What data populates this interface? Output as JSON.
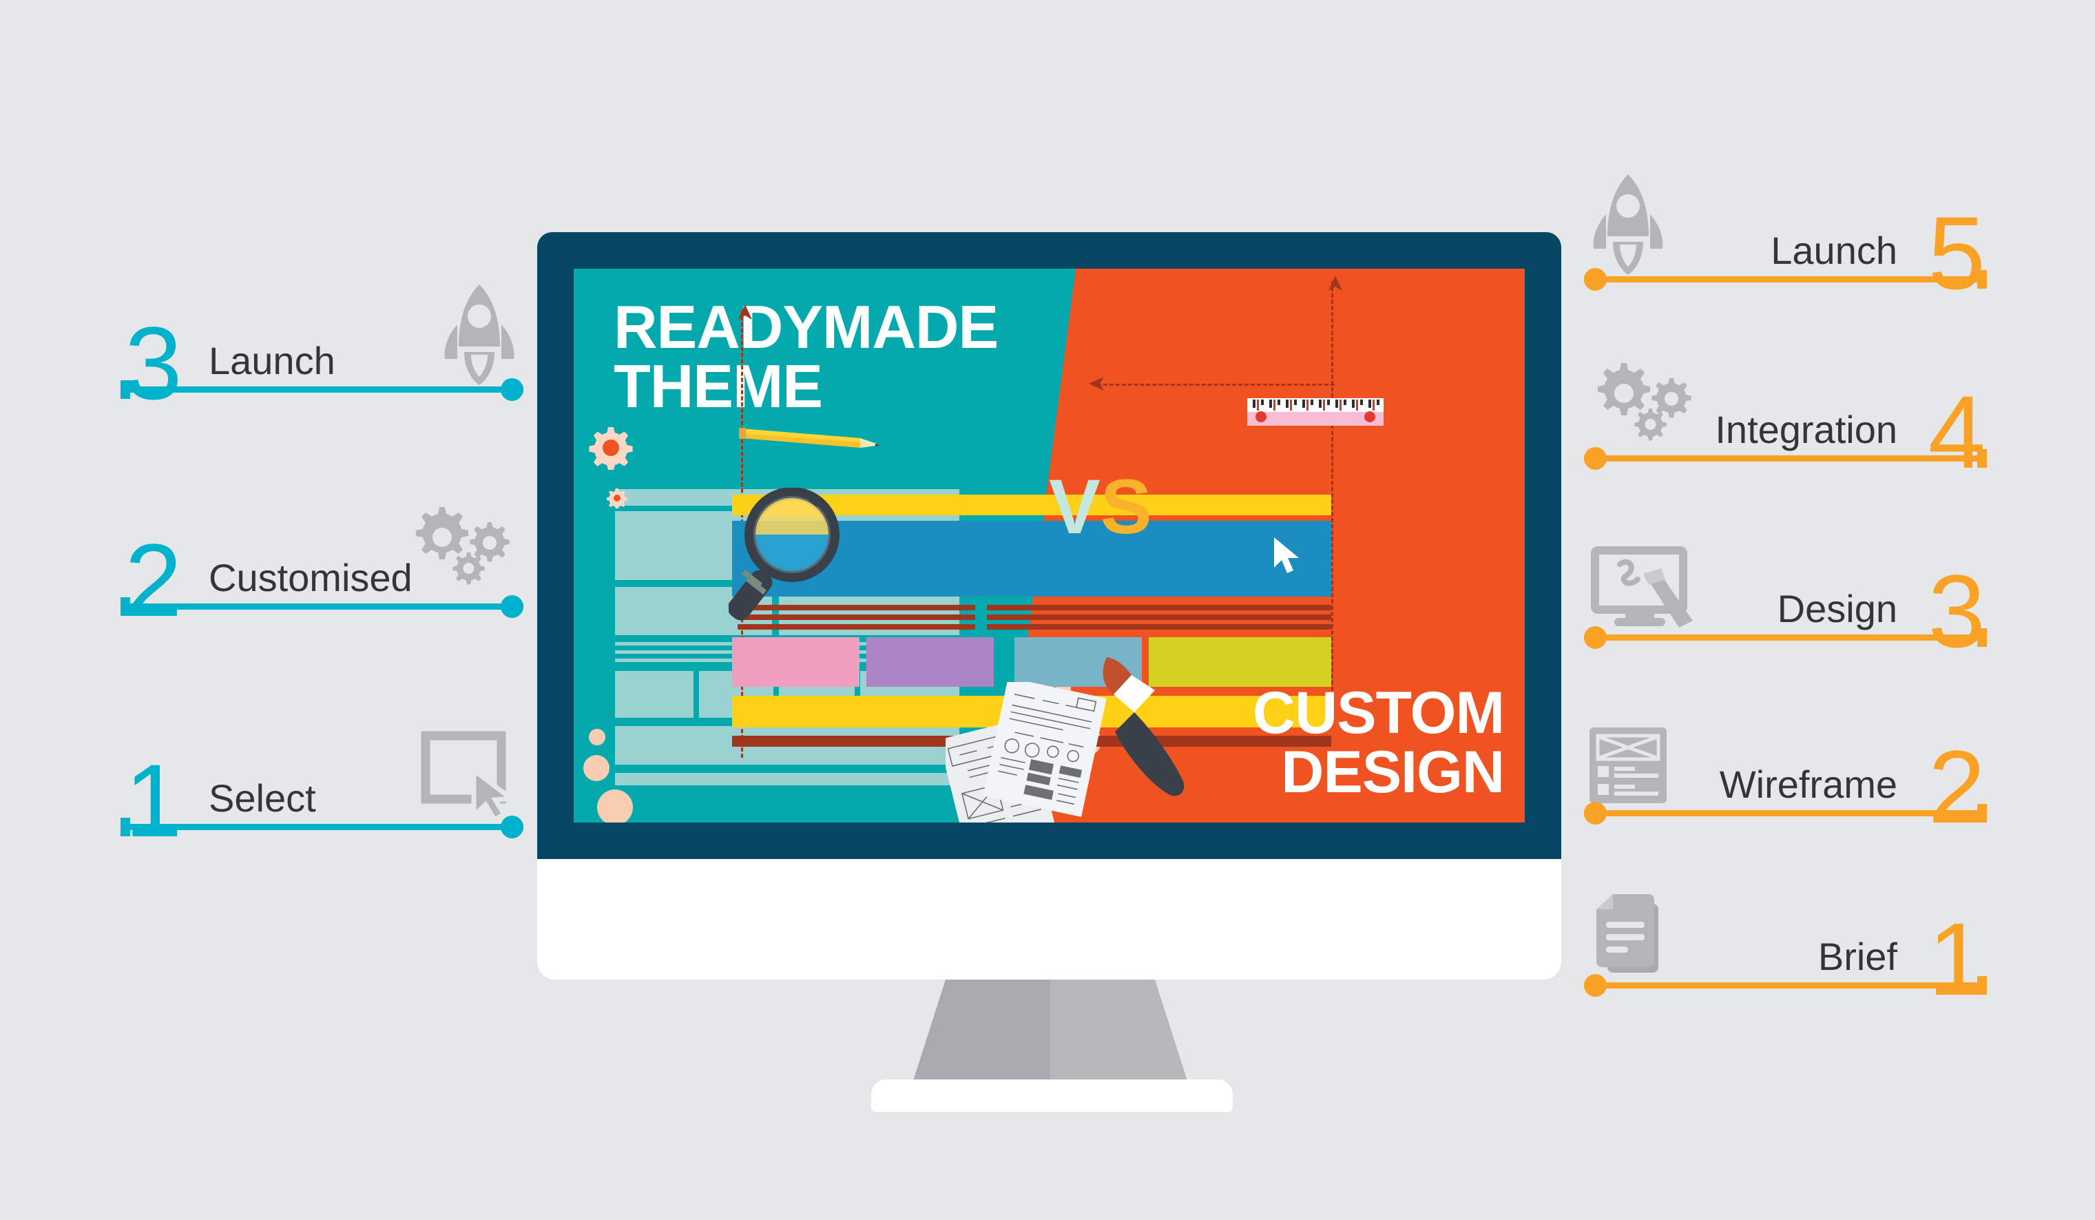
{
  "background_color": "#e6e7e8",
  "palette": {
    "cyan": "#00b2cc",
    "orange_accent": "#f9a226",
    "teal_panel": "#03a9ac",
    "orange_panel": "#f05322",
    "bezel_dark": "#084763",
    "label_text": "#333537",
    "icon_gray": "#b3b5b8",
    "wireframe_block": "#9ad2d2"
  },
  "monitor": {
    "screen": {
      "left_panel": {
        "headline_line1": "READYMADE",
        "headline_line2": "THEME",
        "background_color": "#03a9ac"
      },
      "versus": {
        "v": "V",
        "s": "S"
      },
      "right_panel": {
        "headline_line1": "CUSTOM",
        "headline_line2": "DESIGN",
        "background_color": "#f05322",
        "swatches": [
          "#f09ec0",
          "#ab85c4",
          "#78b3c8",
          "#d6cf24"
        ],
        "hero_bar_color": "#1a8ec0",
        "top_bar_color": "#fcd116",
        "footer_bar_color": "#fed116"
      }
    }
  },
  "left_steps": [
    {
      "number": "3",
      "label": "Launch",
      "icon": "rocket-icon"
    },
    {
      "number": "2",
      "label": "Customised",
      "icon": "gears-icon"
    },
    {
      "number": "1",
      "label": "Select",
      "icon": "select-cursor-icon"
    }
  ],
  "right_steps": [
    {
      "number": "5",
      "label": "Launch",
      "icon": "rocket-icon"
    },
    {
      "number": "4",
      "label": "Integration",
      "icon": "gears-icon"
    },
    {
      "number": "3",
      "label": "Design",
      "icon": "design-tablet-icon"
    },
    {
      "number": "2",
      "label": "Wireframe",
      "icon": "wireframe-icon"
    },
    {
      "number": "1",
      "label": "Brief",
      "icon": "document-icon"
    }
  ]
}
